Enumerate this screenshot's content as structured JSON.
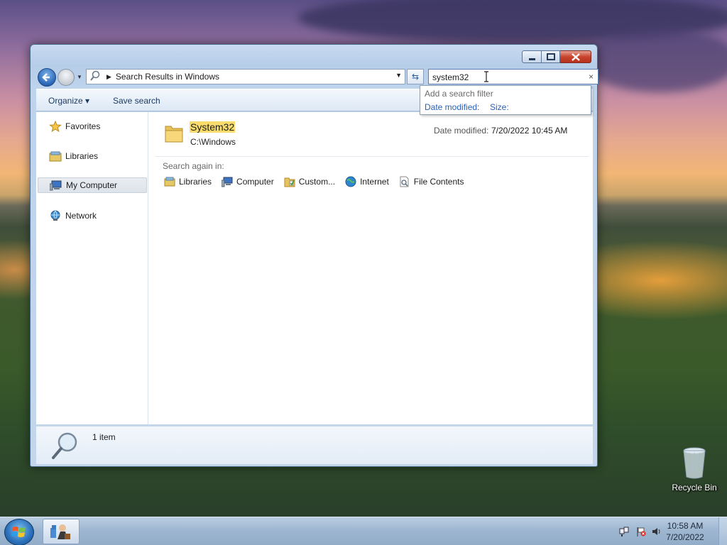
{
  "window": {
    "address_text": "Search Results in Windows",
    "search_value": "system32",
    "search_filter": {
      "title": "Add a search filter",
      "filters": [
        "Date modified:",
        "Size:"
      ]
    },
    "commands": {
      "organize": "Organize ▾",
      "save_search": "Save search"
    },
    "nav_pane": {
      "items": [
        "Favorites",
        "Libraries",
        "My Computer",
        "Network"
      ],
      "selected": "My Computer"
    },
    "result": {
      "name": "System32",
      "path": "C:\\Windows",
      "date_modified_label": "Date modified:",
      "date_modified_value": "7/20/2022 10:45 AM"
    },
    "search_again": {
      "label": "Search again in:",
      "items": [
        "Libraries",
        "Computer",
        "Custom...",
        "Internet",
        "File Contents"
      ]
    },
    "details": {
      "count": "1 item"
    }
  },
  "desktop": {
    "recycle_bin_label": "Recycle Bin"
  },
  "taskbar": {
    "time": "10:58 AM",
    "date": "7/20/2022"
  },
  "colors": {
    "highlight": "#f9dc6b",
    "link": "#2a62b8",
    "close_button": "#c8452d"
  }
}
